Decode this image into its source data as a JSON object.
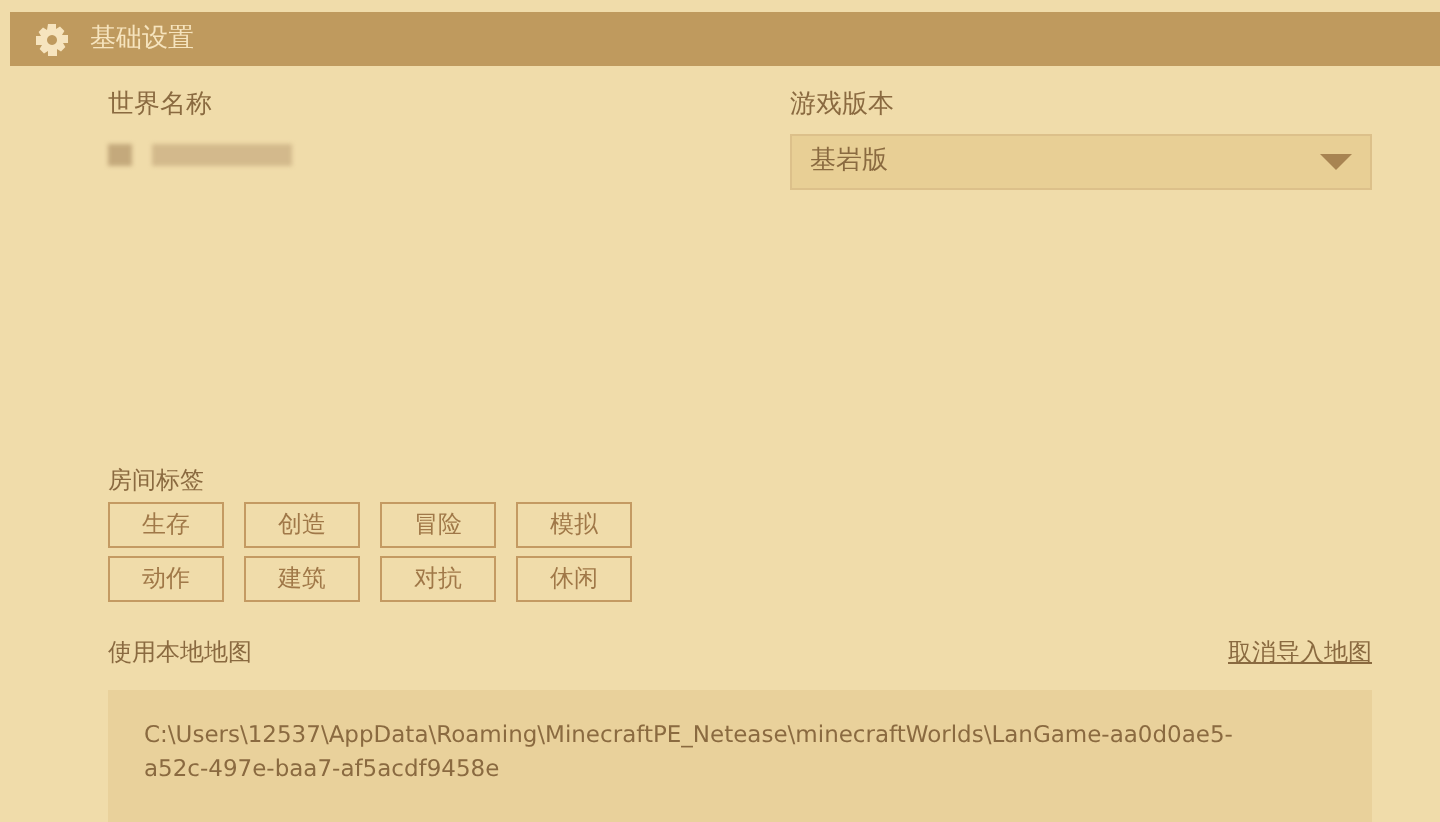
{
  "header": {
    "title": "基础设置"
  },
  "world_name": {
    "label": "世界名称"
  },
  "game_version": {
    "label": "游戏版本",
    "value": "基岩版"
  },
  "room_tags": {
    "label": "房间标签",
    "tags": [
      "生存",
      "创造",
      "冒险",
      "模拟",
      "动作",
      "建筑",
      "对抗",
      "休闲"
    ]
  },
  "local_map": {
    "label": "使用本地地图",
    "cancel_link": "取消导入地图",
    "path": "C:\\Users\\12537\\AppData\\Roaming\\MinecraftPE_Netease\\minecraftWorlds\\LanGame-aa0d0ae5-a52c-497e-baa7-af5acdf9458e"
  }
}
